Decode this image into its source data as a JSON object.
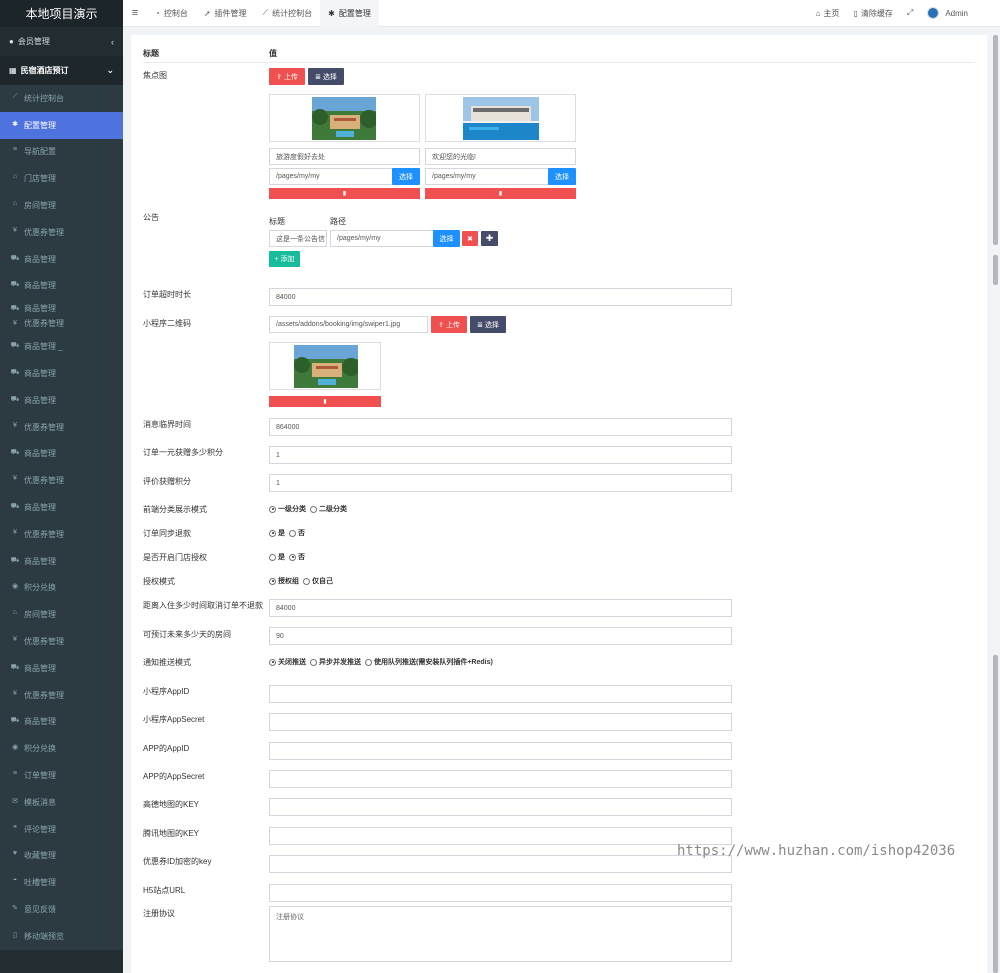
{
  "app": {
    "title": "本地项目演示"
  },
  "sidebar": {
    "member": "会员管理",
    "group_title": "民宿酒店预订",
    "items": [
      {
        "label": "统计控制台",
        "icon": "chart-icon"
      },
      {
        "label": "配置管理",
        "icon": "gear-icon"
      },
      {
        "label": "导航配置",
        "icon": "list-icon"
      },
      {
        "label": "门店管理",
        "icon": "bank-icon"
      },
      {
        "label": "房间管理",
        "icon": "home-icon"
      },
      {
        "label": "优惠券管理",
        "icon": "yen-icon"
      },
      {
        "label": "商品管理",
        "icon": "cart-icon"
      },
      {
        "label": "商品管理",
        "icon": "cart-icon"
      },
      {
        "label": "商品管理",
        "icon": "cart-icon"
      },
      {
        "label": "优惠券管理",
        "icon": "yen-icon"
      },
      {
        "label": "商品管理 _",
        "icon": "cart-icon"
      },
      {
        "label": "商品管理",
        "icon": "cart-icon"
      },
      {
        "label": "商品管理",
        "icon": "cart-icon"
      },
      {
        "label": "优惠券管理",
        "icon": "yen-icon"
      },
      {
        "label": "商品管理",
        "icon": "cart-icon"
      },
      {
        "label": "优惠券管理",
        "icon": "yen-icon"
      },
      {
        "label": "商品管理",
        "icon": "cart-icon"
      },
      {
        "label": "优惠券管理",
        "icon": "yen-icon"
      },
      {
        "label": "商品管理",
        "icon": "cart-icon"
      },
      {
        "label": "积分兑换",
        "icon": "coin-icon"
      },
      {
        "label": "房间管理",
        "icon": "home-icon"
      },
      {
        "label": "优惠券管理",
        "icon": "yen-icon"
      },
      {
        "label": "商品管理",
        "icon": "cart-icon"
      },
      {
        "label": "优惠券管理",
        "icon": "yen-icon"
      },
      {
        "label": "商品管理",
        "icon": "cart-icon"
      },
      {
        "label": "积分兑换",
        "icon": "coin-icon"
      },
      {
        "label": "订单管理",
        "icon": "list-icon"
      },
      {
        "label": "模板消息",
        "icon": "mail-icon"
      },
      {
        "label": "评论管理",
        "icon": "comment-icon"
      },
      {
        "label": "收藏管理",
        "icon": "heart-icon"
      },
      {
        "label": "吐槽管理",
        "icon": "chat-icon"
      },
      {
        "label": "意见反馈",
        "icon": "edit-icon"
      },
      {
        "label": "移动端预览",
        "icon": "mobile-icon"
      }
    ]
  },
  "topbar": {
    "tabs": [
      {
        "label": "控制台",
        "icon": "dashboard-icon"
      },
      {
        "label": "插件管理",
        "icon": "rocket-icon"
      },
      {
        "label": "统计控制台",
        "icon": "chart-icon"
      },
      {
        "label": "配置管理",
        "icon": "gear-icon"
      }
    ],
    "home": "主页",
    "clear_cache": "清除缓存",
    "user": "Admin"
  },
  "table": {
    "col_title": "标题",
    "col_value": "值"
  },
  "focus": {
    "label": "焦点图",
    "upload": "上传",
    "choose": "选择",
    "cards": [
      {
        "title": "旅游度假好去处",
        "path": "/pages/my/my",
        "choose": "选择"
      },
      {
        "title": "欢迎您的光临!",
        "path": "/pages/my/my",
        "choose": "选择"
      }
    ]
  },
  "notice": {
    "label": "公告",
    "col_title": "标题",
    "col_path": "路径",
    "title_value": "这是一条公告信",
    "path_value": "/pages/my/my",
    "choose": "选择",
    "add": "添加"
  },
  "order_timeout": {
    "label": "订单超时时长",
    "value": "84000"
  },
  "qrcode": {
    "label": "小程序二维码",
    "value": "/assets/addons/booking/img/swiper1.jpg",
    "upload": "上传",
    "choose": "选择"
  },
  "msg_time": {
    "label": "消息临界时间",
    "value": "864000"
  },
  "points_per_yuan": {
    "label": "订单一元获赠多少积分",
    "value": "1"
  },
  "review_points": {
    "label": "评价获赠积分",
    "value": "1"
  },
  "category_mode": {
    "label": "前端分类展示模式",
    "options": [
      "一级分类",
      "二级分类"
    ],
    "selected": 0
  },
  "sync_refund": {
    "label": "订单同步退款",
    "options": [
      "是",
      "否"
    ],
    "selected": 0
  },
  "store_auth": {
    "label": "是否开启门店授权",
    "options": [
      "是",
      "否"
    ],
    "selected": 1
  },
  "auth_mode": {
    "label": "授权模式",
    "options": [
      "授权组",
      "仅自己"
    ],
    "selected": 0
  },
  "cancel_before": {
    "label": "距离入住多少时间取消订单不退款",
    "value": "84000"
  },
  "book_days": {
    "label": "可预订未来多少天的房间",
    "value": "90"
  },
  "push_mode": {
    "label": "通知推送模式",
    "options": [
      "关闭推送",
      "异步并发推送",
      "使用队列推送(需安装队列插件+Redis)"
    ],
    "selected": 0
  },
  "fields": [
    {
      "label": "小程序AppID",
      "value": ""
    },
    {
      "label": "小程序AppSecret",
      "value": ""
    },
    {
      "label": "APP的AppID",
      "value": ""
    },
    {
      "label": "APP的AppSecret",
      "value": ""
    },
    {
      "label": "高德地图的KEY",
      "value": ""
    },
    {
      "label": "腾讯地图的KEY",
      "value": ""
    },
    {
      "label": "优惠券ID加密的key",
      "value": ""
    },
    {
      "label": "H5站点URL",
      "value": ""
    }
  ],
  "agreement": {
    "label": "注册协议",
    "placeholder": "注册协议"
  },
  "watermark": "https://www.huzhan.com/ishop42036"
}
